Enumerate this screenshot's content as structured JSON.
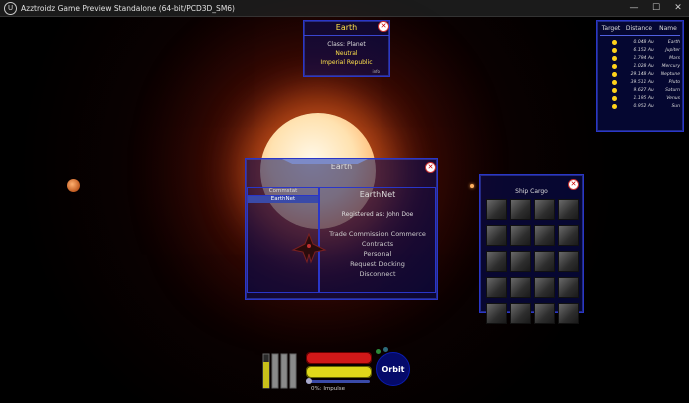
{
  "window": {
    "title": "Azztroidz Game Preview Standalone (64-bit/PCD3D_SM6)",
    "logo_glyph": "U",
    "controls": {
      "minimize": "—",
      "maximize": "☐",
      "close": "✕"
    }
  },
  "info_panel": {
    "title": "Earth",
    "class_text": "Class: Planet",
    "status": "Neutral",
    "faction": "Imperial Republic",
    "tag": "info"
  },
  "target_list": {
    "headers": [
      "Target",
      "Distance",
      "Name"
    ],
    "rows": [
      {
        "distance": "0.048 Au",
        "name": "Earth"
      },
      {
        "distance": "6.152 Au",
        "name": "Jupiter"
      },
      {
        "distance": "1.794 Au",
        "name": "Mars"
      },
      {
        "distance": "1.028 Au",
        "name": "Mercury"
      },
      {
        "distance": "29.148 Au",
        "name": "Neptune"
      },
      {
        "distance": "39.511 Au",
        "name": "Pluto"
      },
      {
        "distance": "9.627 Au",
        "name": "Saturn"
      },
      {
        "distance": "1.195 Au",
        "name": "Venus"
      },
      {
        "distance": "0.952 Au",
        "name": "Sun"
      }
    ]
  },
  "comm_panel": {
    "title": "Earth",
    "left_header": "Commstat",
    "channel": "EarthNet",
    "net_title": "EarthNet",
    "registered": "Registered as: John Doe",
    "options": [
      "Trade Commission Commerce",
      "Contracts",
      "Personal",
      "Request Docking",
      "Disconnect"
    ]
  },
  "cargo_panel": {
    "title": "Ship Cargo",
    "slot_count": 20
  },
  "hud": {
    "speed_label": "0%: Impulse",
    "orbit_label": "Orbit",
    "hull_fraction": 1.0,
    "energy_fraction": 1.0,
    "speed_fraction": 0.0,
    "hull_color": "#d01818",
    "energy_color": "#e0d81a"
  },
  "colors": {
    "panel_border": "#2a36c8",
    "highlight_yellow": "#ffe24a"
  }
}
